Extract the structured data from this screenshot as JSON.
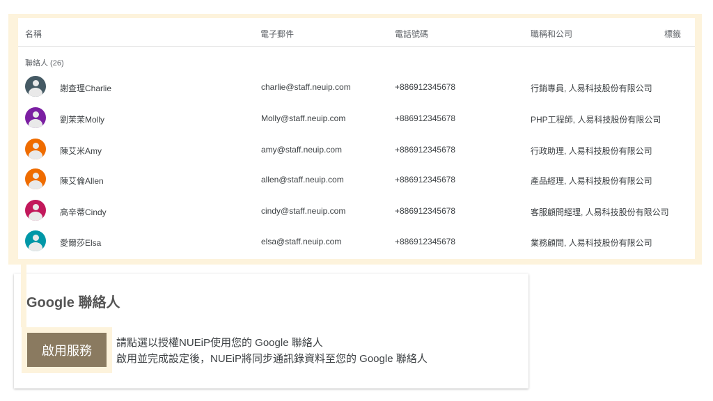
{
  "columns": {
    "name": "名稱",
    "email": "電子郵件",
    "phone": "電話號碼",
    "job": "職稱和公司",
    "labels": "標籤"
  },
  "group_label": "聯絡人 (26)",
  "contacts": [
    {
      "name": "謝查理Charlie",
      "email": "charlie@staff.neuip.com",
      "phone": "+886912345678",
      "job": "行銷專員, 人易科技股份有限公司",
      "avatar_color": "#455a64"
    },
    {
      "name": "劉茉茉Molly",
      "email": "Molly@staff.neuip.com",
      "phone": "+886912345678",
      "job": "PHP工程師, 人易科技股份有限公司",
      "avatar_color": "#7b1fa2"
    },
    {
      "name": "陳艾米Amy",
      "email": "amy@staff.neuip.com",
      "phone": "+886912345678",
      "job": "行政助理, 人易科技股份有限公司",
      "avatar_color": "#ef6c00"
    },
    {
      "name": "陳艾倫Allen",
      "email": "allen@staff.neuip.com",
      "phone": "+886912345678",
      "job": "產品經理, 人易科技股份有限公司",
      "avatar_color": "#ef6c00"
    },
    {
      "name": "高辛蒂Cindy",
      "email": "cindy@staff.neuip.com",
      "phone": "+886912345678",
      "job": "客服顧問經理, 人易科技股份有限公司",
      "avatar_color": "#c2185b"
    },
    {
      "name": "愛爾莎Elsa",
      "email": "elsa@staff.neuip.com",
      "phone": "+886912345678",
      "job": "業務顧問, 人易科技股份有限公司",
      "avatar_color": "#0097a7"
    }
  ],
  "google": {
    "title": "Google 聯絡人",
    "button_label": "啟用服務",
    "desc_line1": "請點選以授權NUEiP使用您的 Google 聯絡人",
    "desc_line2": "啟用並完成設定後，NUEiP將同步通訊錄資料至您的 Google 聯絡人"
  },
  "colors": {
    "highlight": "#fdf3dc",
    "button": "#8a7a60"
  }
}
